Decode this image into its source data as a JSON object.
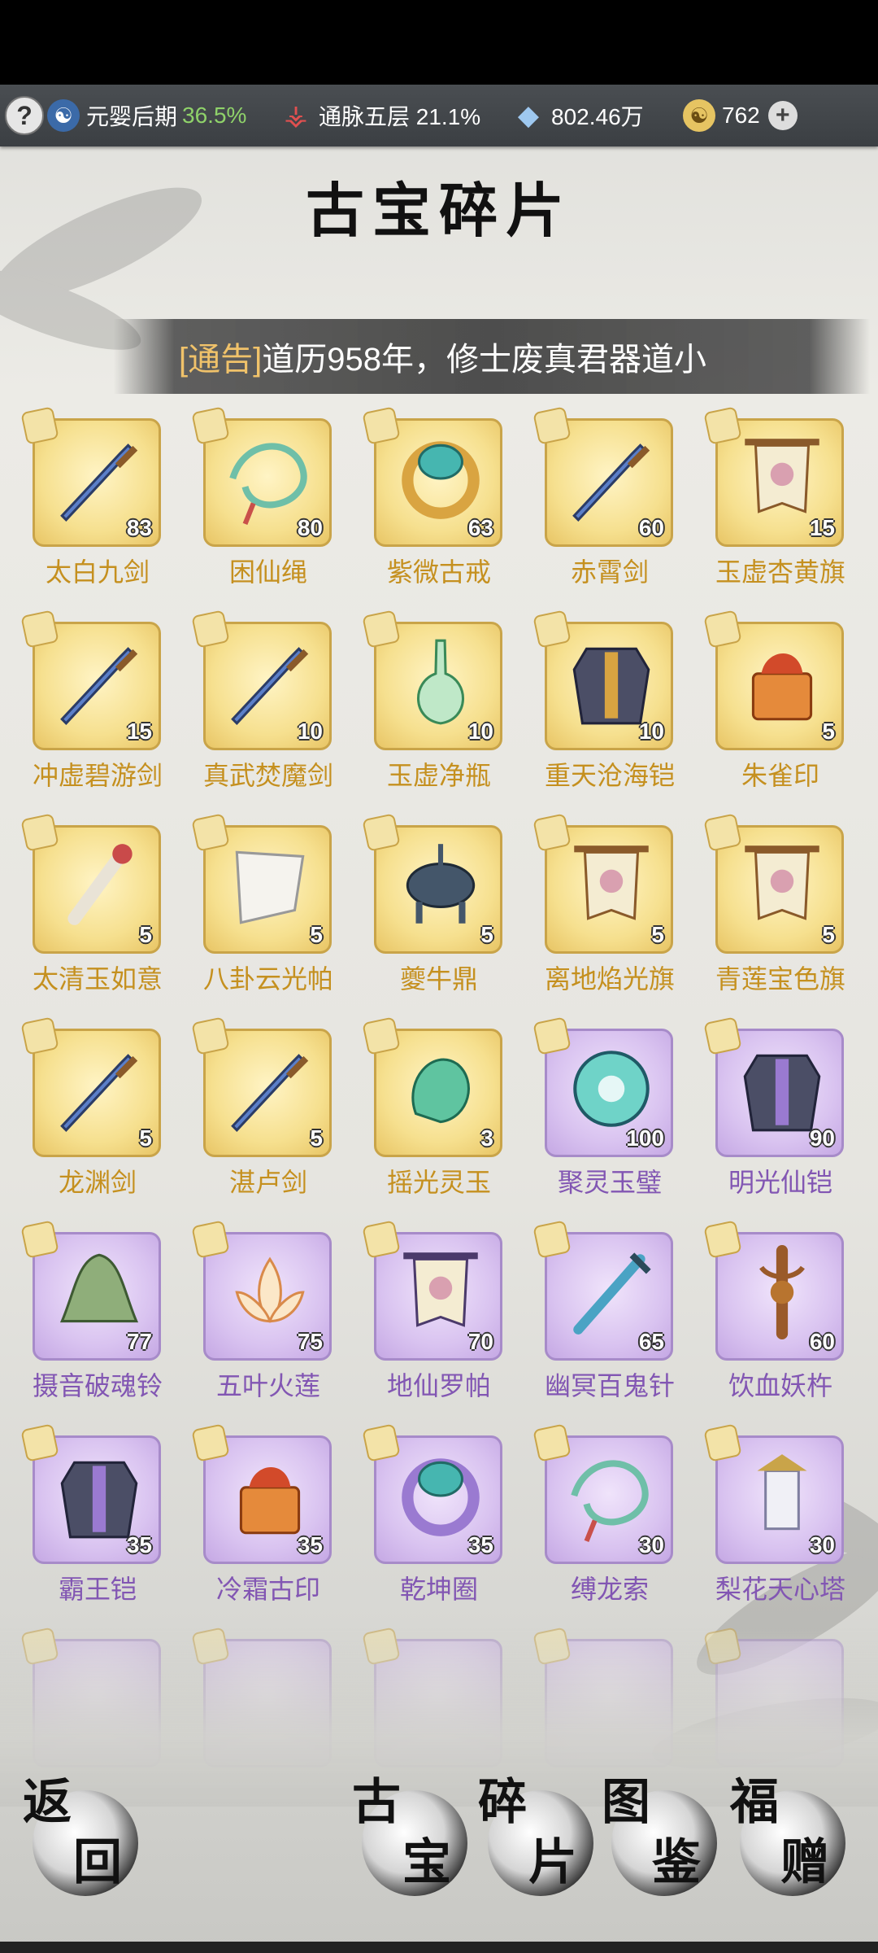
{
  "topbar": {
    "realm_label": "元婴后期",
    "realm_percent": "36.5%",
    "meridian_label": "通脉五层 21.1%",
    "spirit_stones": "802.46万",
    "jade_count": "762"
  },
  "page_title": "古宝碎片",
  "notice": {
    "tag": "[通告]",
    "text": "道历958年，修士废真君器道小"
  },
  "items": [
    {
      "name": "太白九剑",
      "count": "83",
      "rarity": "gold",
      "icon": "sword-icon"
    },
    {
      "name": "困仙绳",
      "count": "80",
      "rarity": "gold",
      "icon": "rope-icon"
    },
    {
      "name": "紫微古戒",
      "count": "63",
      "rarity": "gold",
      "icon": "ring-icon"
    },
    {
      "name": "赤霄剑",
      "count": "60",
      "rarity": "gold",
      "icon": "sword-icon"
    },
    {
      "name": "玉虚杏黄旗",
      "count": "15",
      "rarity": "gold",
      "icon": "banner-icon"
    },
    {
      "name": "冲虚碧游剑",
      "count": "15",
      "rarity": "gold",
      "icon": "sword-icon"
    },
    {
      "name": "真武焚魔剑",
      "count": "10",
      "rarity": "gold",
      "icon": "sword-icon"
    },
    {
      "name": "玉虚净瓶",
      "count": "10",
      "rarity": "gold",
      "icon": "vase-icon"
    },
    {
      "name": "重天沧海铠",
      "count": "10",
      "rarity": "gold",
      "icon": "armor-icon"
    },
    {
      "name": "朱雀印",
      "count": "5",
      "rarity": "gold",
      "icon": "seal-icon"
    },
    {
      "name": "太清玉如意",
      "count": "5",
      "rarity": "gold",
      "icon": "scepter-icon"
    },
    {
      "name": "八卦云光帕",
      "count": "5",
      "rarity": "gold",
      "icon": "cloth-icon"
    },
    {
      "name": "夔牛鼎",
      "count": "5",
      "rarity": "gold",
      "icon": "cauldron-icon"
    },
    {
      "name": "离地焰光旗",
      "count": "5",
      "rarity": "gold",
      "icon": "banner-icon"
    },
    {
      "name": "青莲宝色旗",
      "count": "5",
      "rarity": "gold",
      "icon": "banner-icon"
    },
    {
      "name": "龙渊剑",
      "count": "5",
      "rarity": "gold",
      "icon": "sword-icon"
    },
    {
      "name": "湛卢剑",
      "count": "5",
      "rarity": "gold",
      "icon": "sword-icon"
    },
    {
      "name": "摇光灵玉",
      "count": "3",
      "rarity": "gold",
      "icon": "jade-icon"
    },
    {
      "name": "聚灵玉璧",
      "count": "100",
      "rarity": "purple",
      "icon": "jade-disc-icon"
    },
    {
      "name": "明光仙铠",
      "count": "90",
      "rarity": "purple",
      "icon": "armor-icon"
    },
    {
      "name": "摄音破魂铃",
      "count": "77",
      "rarity": "purple",
      "icon": "bell-icon"
    },
    {
      "name": "五叶火莲",
      "count": "75",
      "rarity": "purple",
      "icon": "lotus-icon"
    },
    {
      "name": "地仙罗帕",
      "count": "70",
      "rarity": "purple",
      "icon": "banner-icon"
    },
    {
      "name": "幽冥百鬼针",
      "count": "65",
      "rarity": "purple",
      "icon": "needle-icon"
    },
    {
      "name": "饮血妖杵",
      "count": "60",
      "rarity": "purple",
      "icon": "vajra-icon"
    },
    {
      "name": "霸王铠",
      "count": "35",
      "rarity": "purple",
      "icon": "armor-icon"
    },
    {
      "name": "冷霜古印",
      "count": "35",
      "rarity": "purple",
      "icon": "seal-icon"
    },
    {
      "name": "乾坤圈",
      "count": "35",
      "rarity": "purple",
      "icon": "ring-icon"
    },
    {
      "name": "缚龙索",
      "count": "30",
      "rarity": "purple",
      "icon": "rope-icon"
    },
    {
      "name": "梨花天心塔",
      "count": "30",
      "rarity": "purple",
      "icon": "tower-icon"
    }
  ],
  "partial_row_rarity": "purple",
  "nav": [
    {
      "id": "back",
      "c1": "返",
      "c2": "回"
    },
    {
      "id": "treasure",
      "c1": "古",
      "c2": "宝"
    },
    {
      "id": "fragments",
      "c1": "碎",
      "c2": "片"
    },
    {
      "id": "catalog",
      "c1": "图",
      "c2": "鉴"
    },
    {
      "id": "gift",
      "c1": "福",
      "c2": "赠"
    }
  ]
}
